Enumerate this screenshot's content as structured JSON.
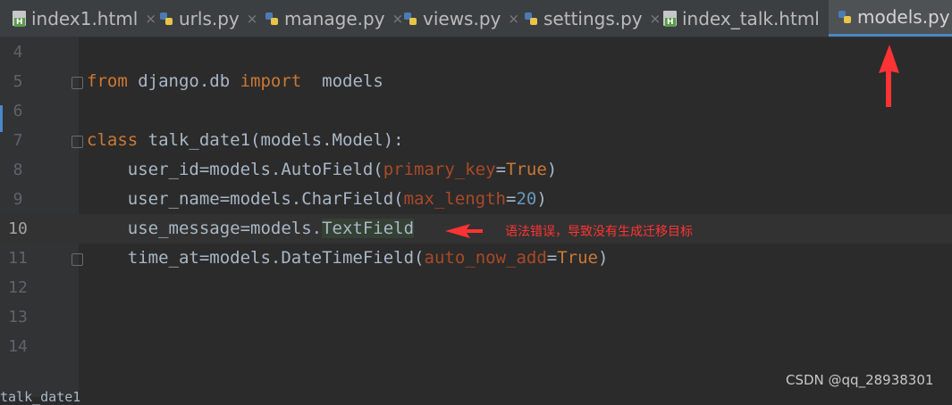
{
  "tabs": [
    {
      "label": "index1.html",
      "type": "html"
    },
    {
      "label": "urls.py",
      "type": "python"
    },
    {
      "label": "manage.py",
      "type": "python"
    },
    {
      "label": "views.py",
      "type": "python"
    },
    {
      "label": "settings.py",
      "type": "python"
    },
    {
      "label": "index_talk.html",
      "type": "html"
    },
    {
      "label": "models.py",
      "type": "python",
      "active": true
    }
  ],
  "close_glyph": "×",
  "line_numbers": [
    "4",
    "5",
    "6",
    "7",
    "8",
    "9",
    "10",
    "11",
    "12",
    "13",
    "14"
  ],
  "code": {
    "l5": {
      "kw1": "from",
      "mod": " django.db ",
      "kw2": "import",
      "rest": "  models"
    },
    "l7": {
      "kw": "class",
      "rest": " talk_date1(models.Model):"
    },
    "l8": {
      "a": "    user_id=models.AutoField(",
      "p": "primary_key",
      "b": "=",
      "c": "True",
      "d": ")"
    },
    "l9": {
      "a": "    user_name=models.CharField(",
      "p": "max_length",
      "b": "=",
      "c": "20",
      "d": ")"
    },
    "l10": {
      "a": "    use_message=models.",
      "h": "TextField"
    },
    "l11": {
      "a": "    time_at=models.DateTimeField(",
      "p": "auto_now_add",
      "b": "=",
      "c": "True",
      "d": ")"
    }
  },
  "annotation": "语法错误，导致没有生成迁移目标",
  "watermark": "CSDN @qq_28938301",
  "bottom_text": "talk_date1",
  "colors": {
    "arrow": "#ff3333",
    "keyword": "#cc7832",
    "param": "#aa4926",
    "number": "#6897bb"
  }
}
